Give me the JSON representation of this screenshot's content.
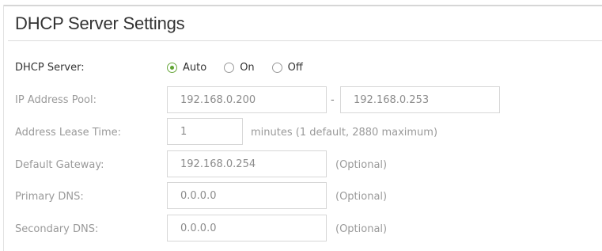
{
  "section": {
    "title": "DHCP Server Settings"
  },
  "dhcp_server": {
    "label": "DHCP Server:",
    "options": [
      {
        "label": "Auto",
        "checked": true
      },
      {
        "label": "On",
        "checked": false
      },
      {
        "label": "Off",
        "checked": false
      }
    ]
  },
  "ip_pool": {
    "label": "IP Address Pool:",
    "start": "192.168.0.200",
    "separator": "-",
    "end": "192.168.0.253"
  },
  "lease_time": {
    "label": "Address Lease Time:",
    "value": "1",
    "hint": "minutes (1 default, 2880 maximum)"
  },
  "gateway": {
    "label": "Default Gateway:",
    "value": "192.168.0.254",
    "hint": "(Optional)"
  },
  "primary_dns": {
    "label": "Primary DNS:",
    "value": "0.0.0.0",
    "hint": "(Optional)"
  },
  "secondary_dns": {
    "label": "Secondary DNS:",
    "value": "0.0.0.0",
    "hint": "(Optional)"
  },
  "colors": {
    "radio_selected": "#5fa332",
    "label_muted": "#9a9a9a",
    "text_dark": "#333333",
    "border": "#d7d7d7"
  }
}
